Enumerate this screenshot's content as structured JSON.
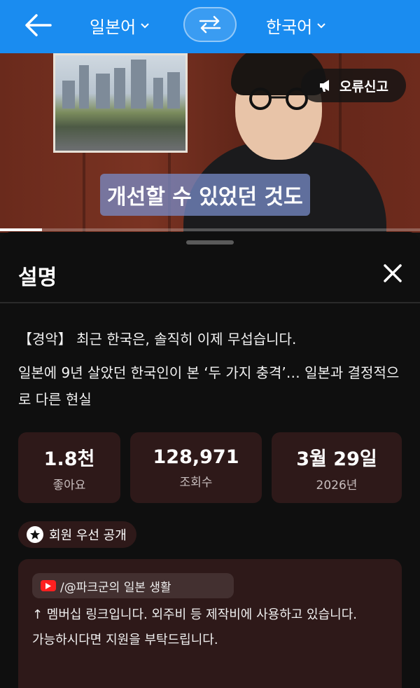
{
  "topbar": {
    "source_lang": "일본어",
    "target_lang": "한국어",
    "icons": [
      "back-arrow-icon",
      "chevron-down-icon",
      "swap-icon"
    ]
  },
  "video": {
    "report_label": "오류신고",
    "subtitle": "개선할 수 있었던 것도",
    "progress": 0.1
  },
  "sheet": {
    "title": "설명",
    "description_line1": "【경악】 최근 한국은, 솔직히 이제 무섭습니다.",
    "description_line2": "일본에 9년 살았던 한국인이 본 ‘두 가지 충격’… 일본과 결정적으로 다른 현실",
    "stats": [
      {
        "value": "1.8천",
        "label": "좋아요"
      },
      {
        "value": "128,971",
        "label": "조회수"
      },
      {
        "value": "3월 29일",
        "label": "2026년"
      }
    ],
    "member_badge": "회원 우선 공개",
    "post": {
      "channel": "/@파크군의 일본 생활",
      "line1": "↑ 멤버십 링크입니다. 외주비 등 제작비에 사용하고 있습니다.",
      "line2": "가능하시다면 지원을 부탁드립니다."
    }
  },
  "colors": {
    "topbar": "#1a8cf0",
    "sheet_bg": "#0f0f0f",
    "card_bg": "#2e1919"
  }
}
